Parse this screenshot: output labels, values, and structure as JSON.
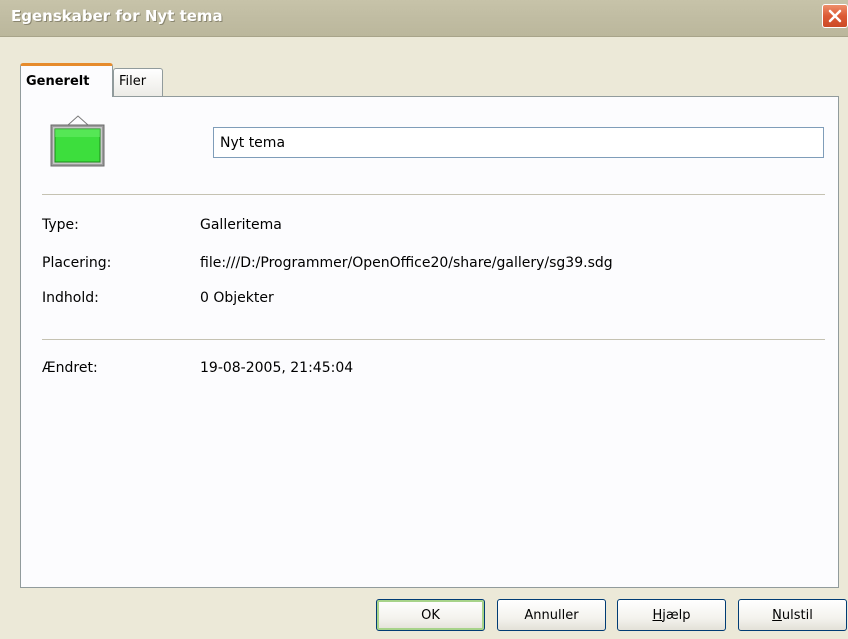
{
  "window": {
    "title": "Egenskaber for Nyt tema"
  },
  "tabs": [
    {
      "label": "Generelt",
      "active": true
    },
    {
      "label": "Filer",
      "active": false
    }
  ],
  "theme": {
    "icon": "gallery-theme-icon",
    "name_value": "Nyt tema"
  },
  "info": {
    "type_label": "Type:",
    "type_value": "Galleritema",
    "location_label": "Placering:",
    "location_value": "file:///D:/Programmer/OpenOffice20/share/gallery/sg39.sdg",
    "contents_label": "Indhold:",
    "contents_value": "0 Objekter",
    "modified_label": "Ændret:",
    "modified_value": "19-08-2005, 21:45:04"
  },
  "buttons": {
    "ok": "OK",
    "cancel": "Annuller",
    "help_prefix": "",
    "help_mnemonic": "H",
    "help_rest": "jælp",
    "reset_prefix": "",
    "reset_mnemonic": "N",
    "reset_rest": "ulstil"
  },
  "colors": {
    "window_bg": "#ece9d8",
    "titlebar": "#c1bda3",
    "close_button": "#dc5a35",
    "active_tab_accent": "#e68b2c",
    "theme_icon_fill": "#3dde3d"
  }
}
